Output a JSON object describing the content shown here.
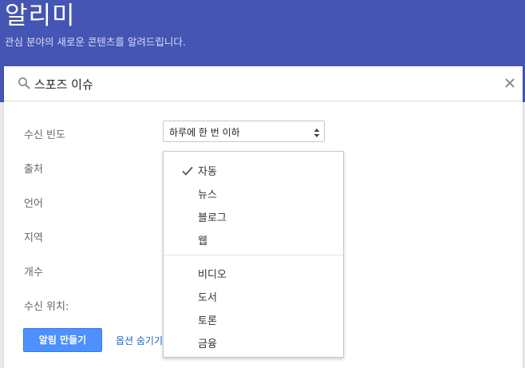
{
  "header": {
    "title": "알리미",
    "subtitle": "관심 분야의 새로운 콘텐츠를 알려드립니다.",
    "background_color": "#4555b4"
  },
  "search": {
    "query": "스포즈 이슈",
    "icon": "search-icon",
    "clear_icon": "close-icon"
  },
  "options": {
    "frequency_label": "수신 빈도",
    "frequency_value": "하루에 한 번 이하",
    "source_label": "출처",
    "language_label": "언어",
    "region_label": "지역",
    "count_label": "개수",
    "deliver_to_label": "수신 위치:"
  },
  "actions": {
    "create_label": "알림 만들기",
    "hide_options_label": "옵션 숨기기",
    "button_color": "#4d90fe"
  },
  "source_dropdown": {
    "items": [
      {
        "label": "자동",
        "checked": true
      },
      {
        "label": "뉴스",
        "checked": false
      },
      {
        "label": "블로그",
        "checked": false
      },
      {
        "label": "웹",
        "checked": false
      },
      {
        "label": "비디오",
        "checked": false
      },
      {
        "label": "도서",
        "checked": false
      },
      {
        "label": "토론",
        "checked": false
      },
      {
        "label": "금융",
        "checked": false
      }
    ]
  }
}
